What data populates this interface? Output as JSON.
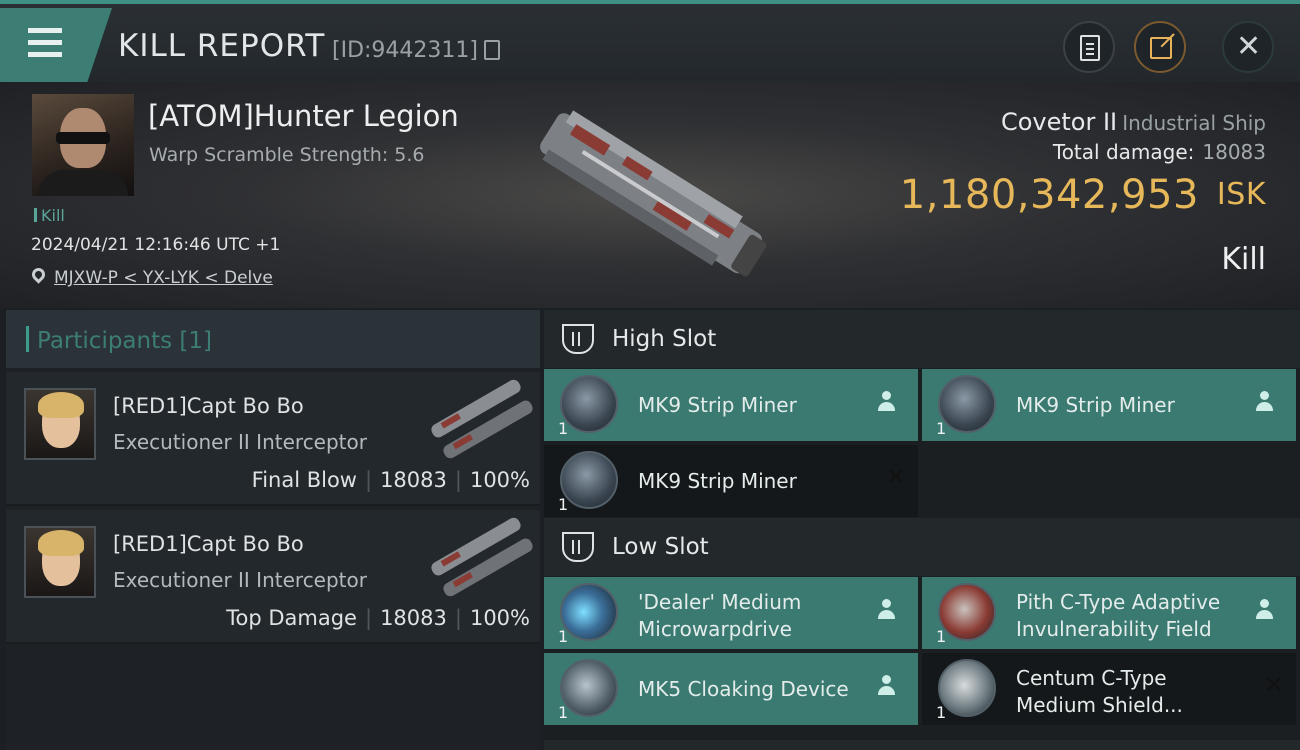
{
  "topbar": {
    "title": "KILL REPORT",
    "report_id": "[ID:9442311]"
  },
  "victim": {
    "name": "[ATOM]Hunter Legion",
    "warp_scramble": "Warp Scramble Strength: 5.6",
    "tag": "Kill",
    "datetime": "2024/04/21 12:16:46 UTC +1",
    "location": "MJXW-P < YX-LYK < Delve"
  },
  "ship": {
    "name": "Covetor II",
    "class": "Industrial Ship",
    "total_damage_label": "Total damage:",
    "total_damage_value": "18083",
    "isk_value": "1,180,342,953",
    "isk_unit": "ISK",
    "result": "Kill"
  },
  "participants": {
    "title": "Participants",
    "count": "[1]",
    "cards": [
      {
        "name": "[RED1]Capt Bo Bo",
        "ship": "Executioner II Interceptor",
        "role": "Final Blow",
        "damage": "18083",
        "percent": "100%"
      },
      {
        "name": "[RED1]Capt Bo Bo",
        "ship": "Executioner II Interceptor",
        "role": "Top Damage",
        "damage": "18083",
        "percent": "100%"
      }
    ]
  },
  "fittings": {
    "high_slot": {
      "title": "High Slot",
      "modules": [
        {
          "name": "MK9 Strip Miner",
          "qty": "1",
          "status": "dropped"
        },
        {
          "name": "MK9 Strip Miner",
          "qty": "1",
          "status": "dropped"
        },
        {
          "name": "MK9 Strip Miner",
          "qty": "1",
          "status": "destroyed"
        }
      ]
    },
    "low_slot": {
      "title": "Low Slot",
      "modules": [
        {
          "name_line1": "'Dealer' Medium",
          "name_line2": "Microwarpdrive",
          "qty": "1",
          "status": "dropped"
        },
        {
          "name_line1": "Pith C-Type Adaptive",
          "name_line2": "Invulnerability Field",
          "qty": "1",
          "status": "dropped"
        },
        {
          "name": "MK5 Cloaking Device",
          "qty": "1",
          "status": "dropped"
        },
        {
          "name_line1": "Centum C-Type",
          "name_line2": "Medium Shield...",
          "qty": "1",
          "status": "destroyed"
        }
      ]
    }
  },
  "colors": {
    "accent_teal": "#3c7d74",
    "isk_gold": "#e6b85a"
  }
}
